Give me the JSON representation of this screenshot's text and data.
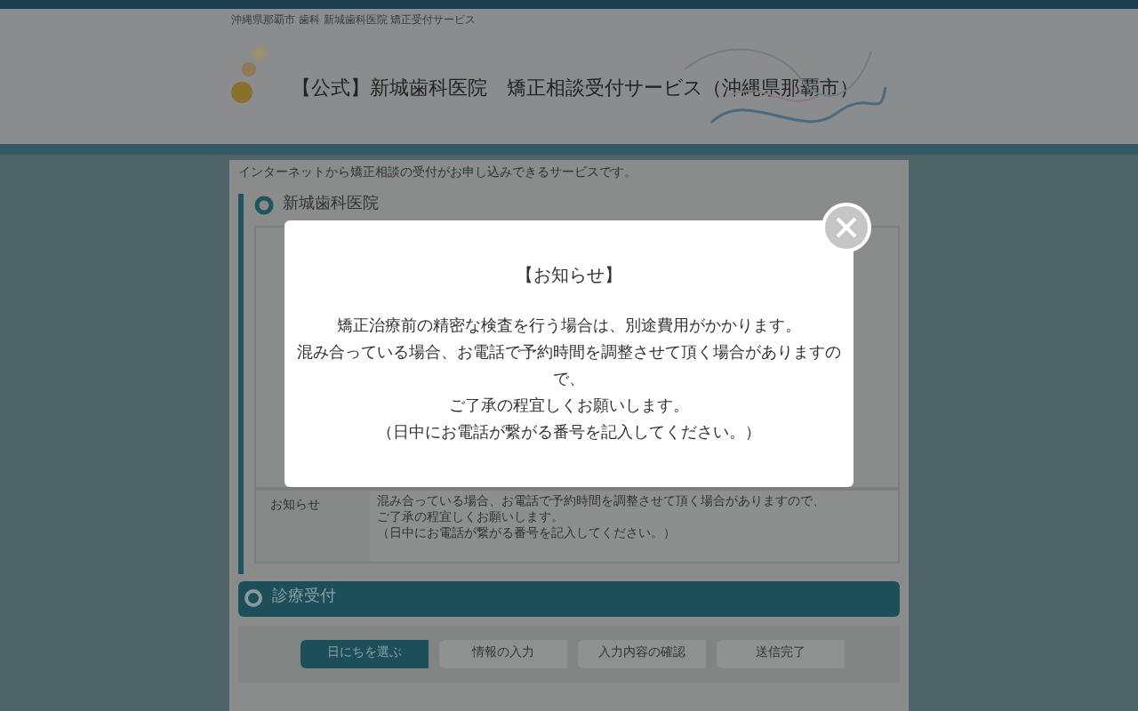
{
  "header": {
    "breadcrumb": "沖縄県那覇市 歯科 新城歯科医院 矯正受付サービス",
    "title": "【公式】新城歯科医院　矯正相談受付サービス（沖縄県那覇市）"
  },
  "intro": "インターネットから矯正相談の受付がお申し込みできるサービスです。",
  "clinic_section": {
    "title": "新城歯科医院",
    "notice_label": "お知らせ",
    "notice_lines": [
      "混み合っている場合、お電話で予約時間を調整させて頂く場合がありますので、",
      "ご了承の程宜しくお願いします。",
      "（日中にお電話が繋がる番号を記入してください。）"
    ]
  },
  "booking_section": {
    "title": "診療受付",
    "steps": [
      {
        "label": "日にちを選ぶ",
        "selected": true
      },
      {
        "label": "情報の入力",
        "selected": false
      },
      {
        "label": "入力内容の確認",
        "selected": false
      },
      {
        "label": "送信完了",
        "selected": false
      }
    ]
  },
  "modal": {
    "title": "【お知らせ】",
    "lines": [
      "矯正治療前の精密な検査を行う場合は、別途費用がかかります。",
      "混み合っている場合、お電話で予約時間を調整させて頂く場合がありますので、",
      "ご了承の程宜しくお願いします。",
      "（日中にお電話が繋がる番号を記入してください。）"
    ]
  }
}
